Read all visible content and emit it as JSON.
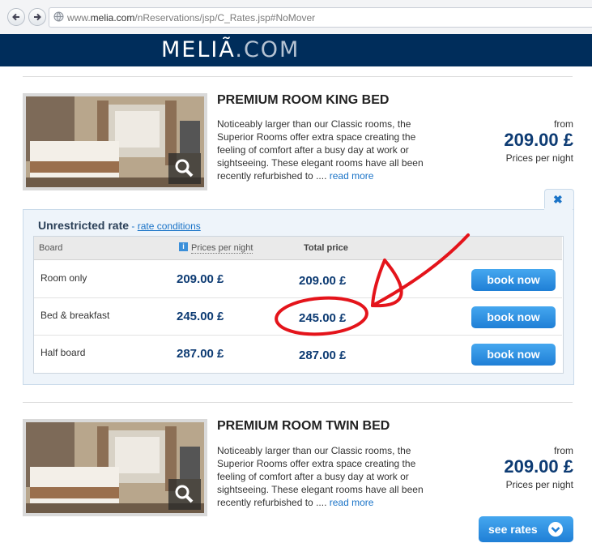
{
  "browser": {
    "url_prefix": "www.",
    "url_host": "melia.com",
    "url_path": "/nReservations/jsp/C_Rates.jsp#NoMover"
  },
  "header": {
    "logo_main": "MELIÃ",
    "logo_suffix": ".COM",
    "bg_color": "#002d5b"
  },
  "rooms": [
    {
      "title": "PREMIUM ROOM KING BED",
      "description": "Noticeably larger than our Classic rooms, the Superior Rooms offer extra space creating the feeling of comfort after a busy day at work or sightseeing. These elegant rooms have all been recently refurbished to ....",
      "read_more": "read more",
      "from_label": "from",
      "price": "209.00 £",
      "price_note": "Prices per night"
    },
    {
      "title": "PREMIUM ROOM TWIN BED",
      "description": "Noticeably larger than our Classic rooms, the Superior Rooms offer extra space creating the feeling of comfort after a busy day at work or sightseeing. These elegant rooms have all been recently refurbished to ....",
      "read_more": "read more",
      "from_label": "from",
      "price": "209.00 £",
      "price_note": "Prices per night",
      "see_rates": "see rates"
    }
  ],
  "rates": {
    "title": "Unrestricted rate",
    "separator": " - ",
    "conditions_link": "rate conditions",
    "close_symbol": "✖",
    "columns": {
      "board": "Board",
      "per_night": "Prices per night",
      "total": "Total price",
      "info_icon": "i"
    },
    "rows": [
      {
        "board": "Room only",
        "per_night": "209.00 £",
        "total": "209.00 £",
        "button": "book now"
      },
      {
        "board": "Bed & breakfast",
        "per_night": "245.00 £",
        "total": "245.00 £",
        "button": "book now"
      },
      {
        "board": "Half board",
        "per_night": "287.00 £",
        "total": "287.00 £",
        "button": "book now"
      }
    ]
  },
  "colors": {
    "price": "#0d3b73",
    "button": "#1f7fd6",
    "annotation": "#e4141b"
  }
}
